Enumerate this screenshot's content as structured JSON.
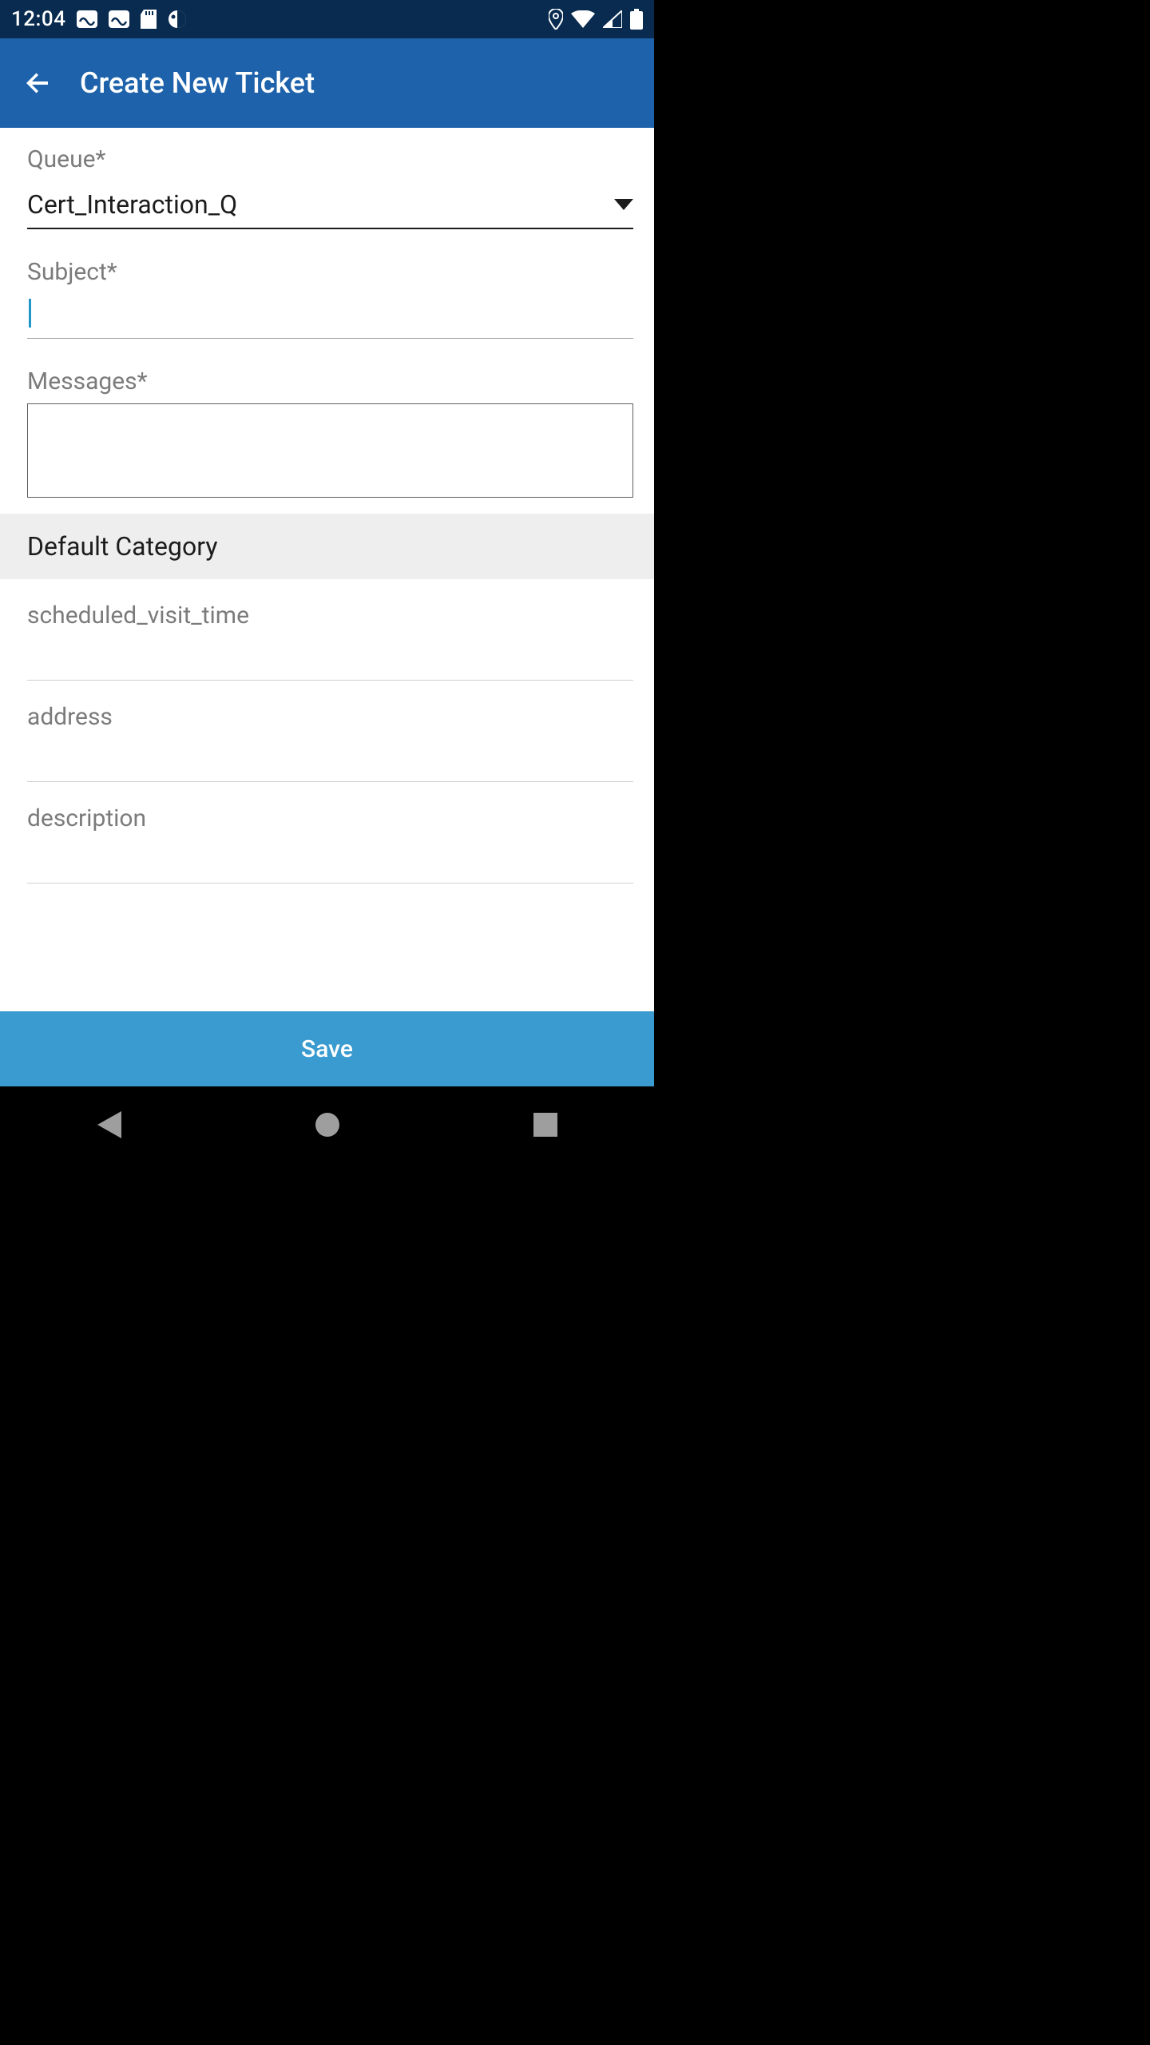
{
  "status_bar": {
    "time": "12:04"
  },
  "app_bar": {
    "title": "Create New Ticket"
  },
  "form": {
    "queue_label": "Queue*",
    "queue_value": "Cert_Interaction_Q",
    "subject_label": "Subject*",
    "subject_value": "",
    "messages_label": "Messages*",
    "messages_value": ""
  },
  "category": {
    "header": "Default Category",
    "fields": [
      {
        "label": "scheduled_visit_time",
        "value": ""
      },
      {
        "label": "address",
        "value": ""
      },
      {
        "label": "description",
        "value": ""
      }
    ]
  },
  "actions": {
    "save_label": "Save"
  }
}
